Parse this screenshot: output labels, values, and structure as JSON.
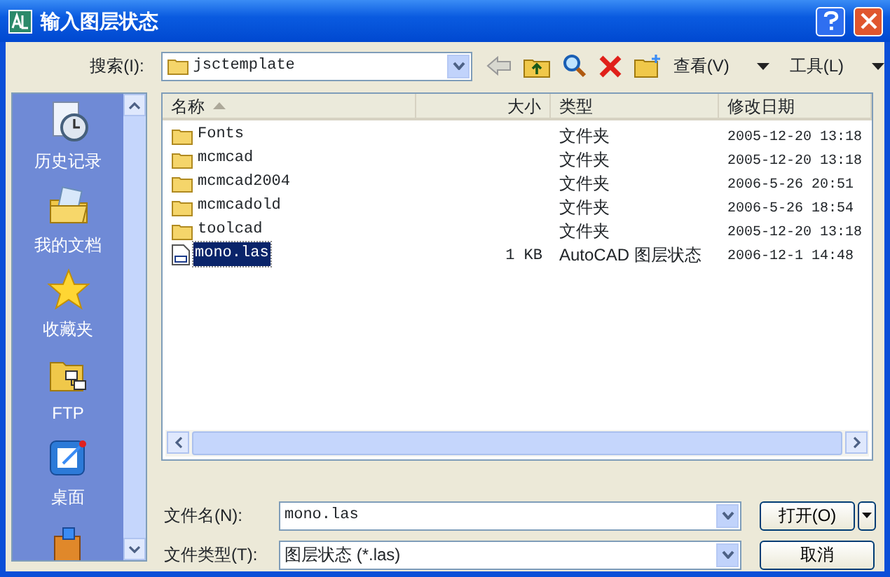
{
  "window": {
    "title": "输入图层状态"
  },
  "toolbar": {
    "look_in_label": "搜索(I):",
    "look_in_value": "jsctemplate",
    "view_menu": "查看(V)",
    "tools_menu": "工具(L)"
  },
  "sidebar": {
    "items": [
      {
        "kind": "history",
        "label": "历史记录"
      },
      {
        "kind": "documents",
        "label": "我的文档"
      },
      {
        "kind": "favorites",
        "label": "收藏夹"
      },
      {
        "kind": "ftp",
        "label": "FTP"
      },
      {
        "kind": "desktop",
        "label": "桌面"
      },
      {
        "kind": "buzzsaw"
      }
    ]
  },
  "file_list": {
    "columns": [
      {
        "label": "名称",
        "sorted": true
      },
      {
        "label": "大小",
        "sorted": false
      },
      {
        "label": "类型",
        "sorted": false
      },
      {
        "label": "修改日期",
        "sorted": false
      }
    ],
    "rows": [
      {
        "kind": "folder",
        "name": "Fonts",
        "size": "",
        "type": "文件夹",
        "modified": "2005-12-20 13:18",
        "selected": false
      },
      {
        "kind": "folder",
        "name": "mcmcad",
        "type": "文件夹",
        "modified": "2005-12-20 13:18",
        "selected": false
      },
      {
        "kind": "folder",
        "name": "mcmcad2004",
        "type": "文件夹",
        "modified": "2006-5-26 20:51",
        "selected": false
      },
      {
        "kind": "folder",
        "name": "mcmcadold",
        "type": "文件夹",
        "modified": "2006-5-26 18:54",
        "selected": false
      },
      {
        "kind": "folder",
        "name": "toolcad",
        "type": "文件夹",
        "modified": "2005-12-20 13:18",
        "selected": false
      },
      {
        "kind": "file",
        "name": "mono.las",
        "size": "1 KB",
        "type": "AutoCAD 图层状态",
        "modified": "2006-12-1 14:48",
        "selected": true
      }
    ]
  },
  "file_name": {
    "label": "文件名(N):",
    "value": "mono.las"
  },
  "file_type": {
    "label": "文件类型(T):",
    "value": "图层状态 (*.las)"
  },
  "buttons": {
    "open": "打开(O)",
    "cancel": "取消"
  }
}
